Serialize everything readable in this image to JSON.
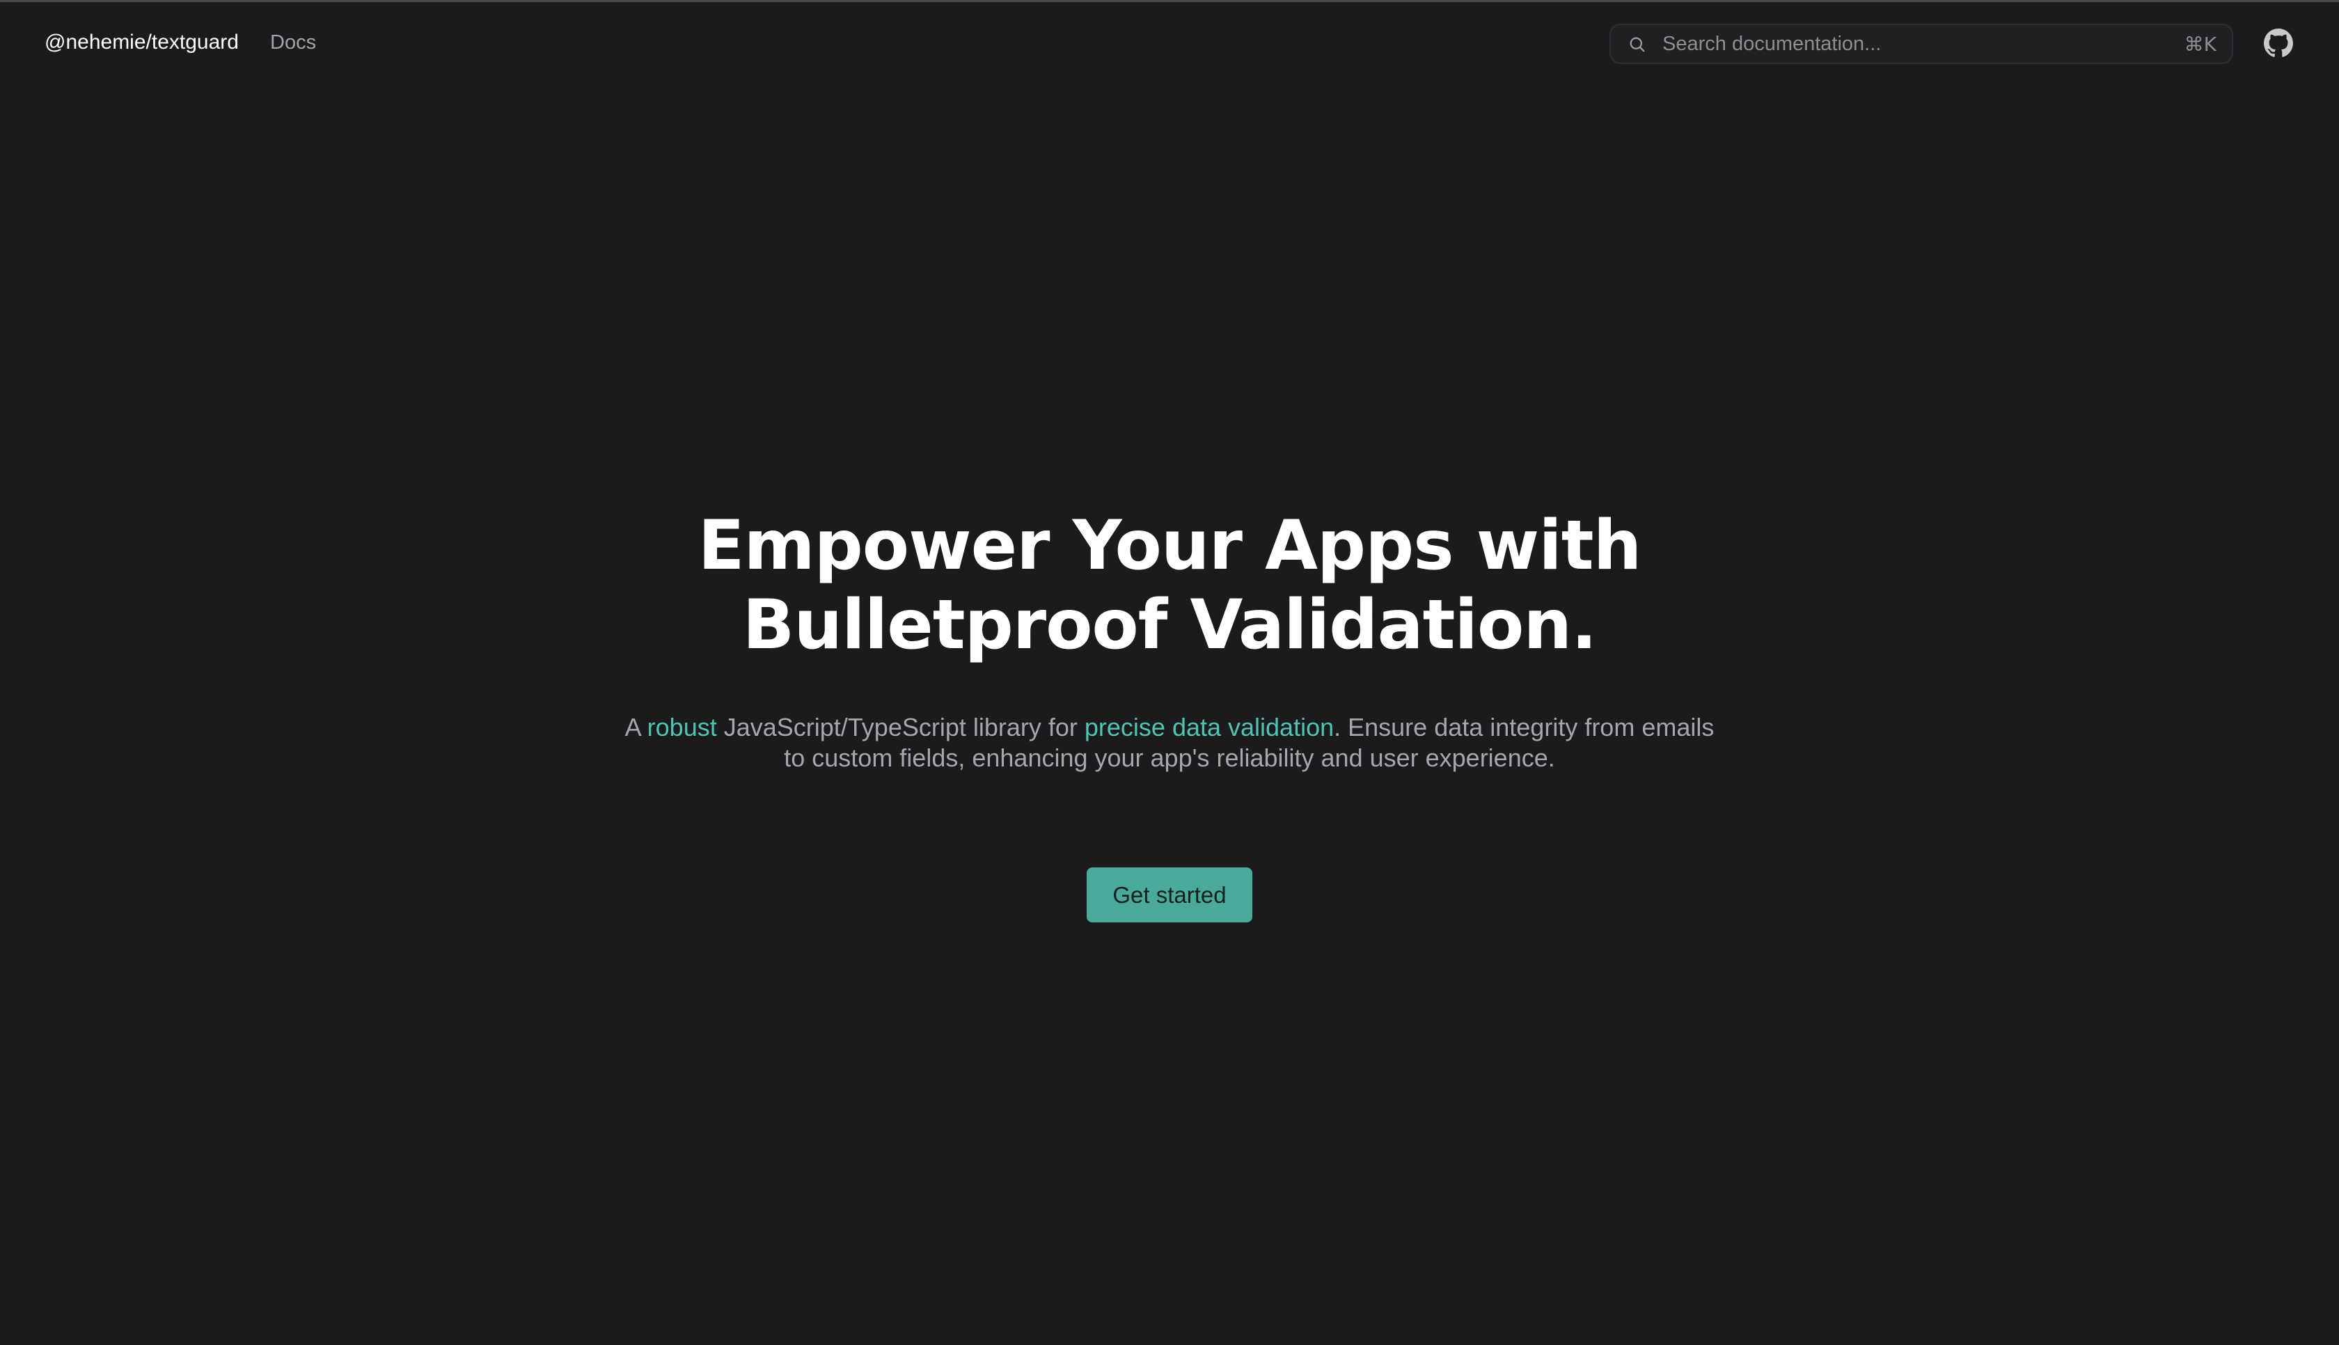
{
  "navbar": {
    "brand": "@nehemie/textguard",
    "docs_link": "Docs",
    "search": {
      "placeholder": "Search documentation...",
      "value": "",
      "shortcut": "⌘K",
      "icon": "search-icon"
    },
    "github_icon": "github-icon"
  },
  "hero": {
    "title_line1": "Empower Your Apps with",
    "title_line2": "Bulletproof Validation.",
    "subtitle": {
      "part1": "A ",
      "accent1": "robust",
      "part2": " JavaScript/TypeScript library for ",
      "accent2": "precise data validation",
      "part3": ". Ensure data integrity from emails to custom fields, enhancing your app's reliability and user experience."
    },
    "cta_label": "Get started"
  },
  "colors": {
    "background": "#1b1b1d",
    "accent": "#4fc4b2",
    "button": "#4aaa9a",
    "text_primary": "#ffffff",
    "text_muted": "#a6a6ab"
  }
}
